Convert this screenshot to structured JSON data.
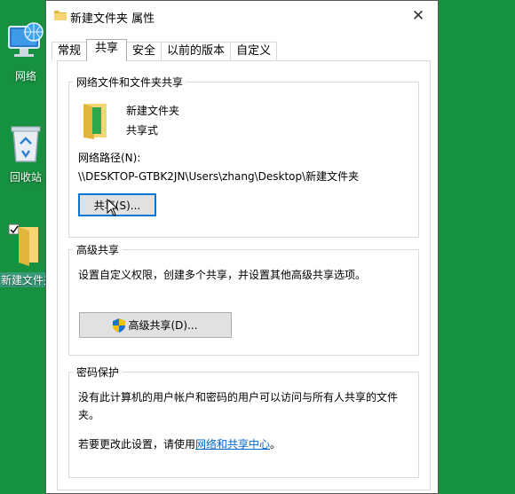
{
  "desktop": {
    "icons": [
      {
        "label": "网络"
      },
      {
        "label": "回收站"
      },
      {
        "label": "新建文件夹"
      }
    ]
  },
  "window": {
    "title": "新建文件夹 属性",
    "close_label": "✕",
    "tabs": [
      {
        "label": "常规"
      },
      {
        "label": "共享",
        "active": true
      },
      {
        "label": "安全"
      },
      {
        "label": "以前的版本"
      },
      {
        "label": "自定义"
      }
    ]
  },
  "sharing": {
    "group_title": "网络文件和文件夹共享",
    "folder_name": "新建文件夹",
    "share_state": "共享式",
    "path_label": "网络路径(N):",
    "path_value": "\\\\DESKTOP-GTBK2JN\\Users\\zhang\\Desktop\\新建文件夹",
    "share_button": "共享(S)..."
  },
  "advanced": {
    "group_title": "高级共享",
    "description": "设置自定义权限，创建多个共享，并设置其他高级共享选项。",
    "button": "高级共享(D)..."
  },
  "password": {
    "group_title": "密码保护",
    "desc_line1": "没有此计算机的用户帐户和密码的用户可以访问与所有人共享的文件",
    "desc_line2": "夹。",
    "change_prefix": "若要更改此设置，请使用",
    "link": "网络和共享中心",
    "change_suffix": "。"
  },
  "colors": {
    "desktop_bg": "#16913f",
    "link": "#0066cc",
    "focus_border": "#0078d7"
  }
}
